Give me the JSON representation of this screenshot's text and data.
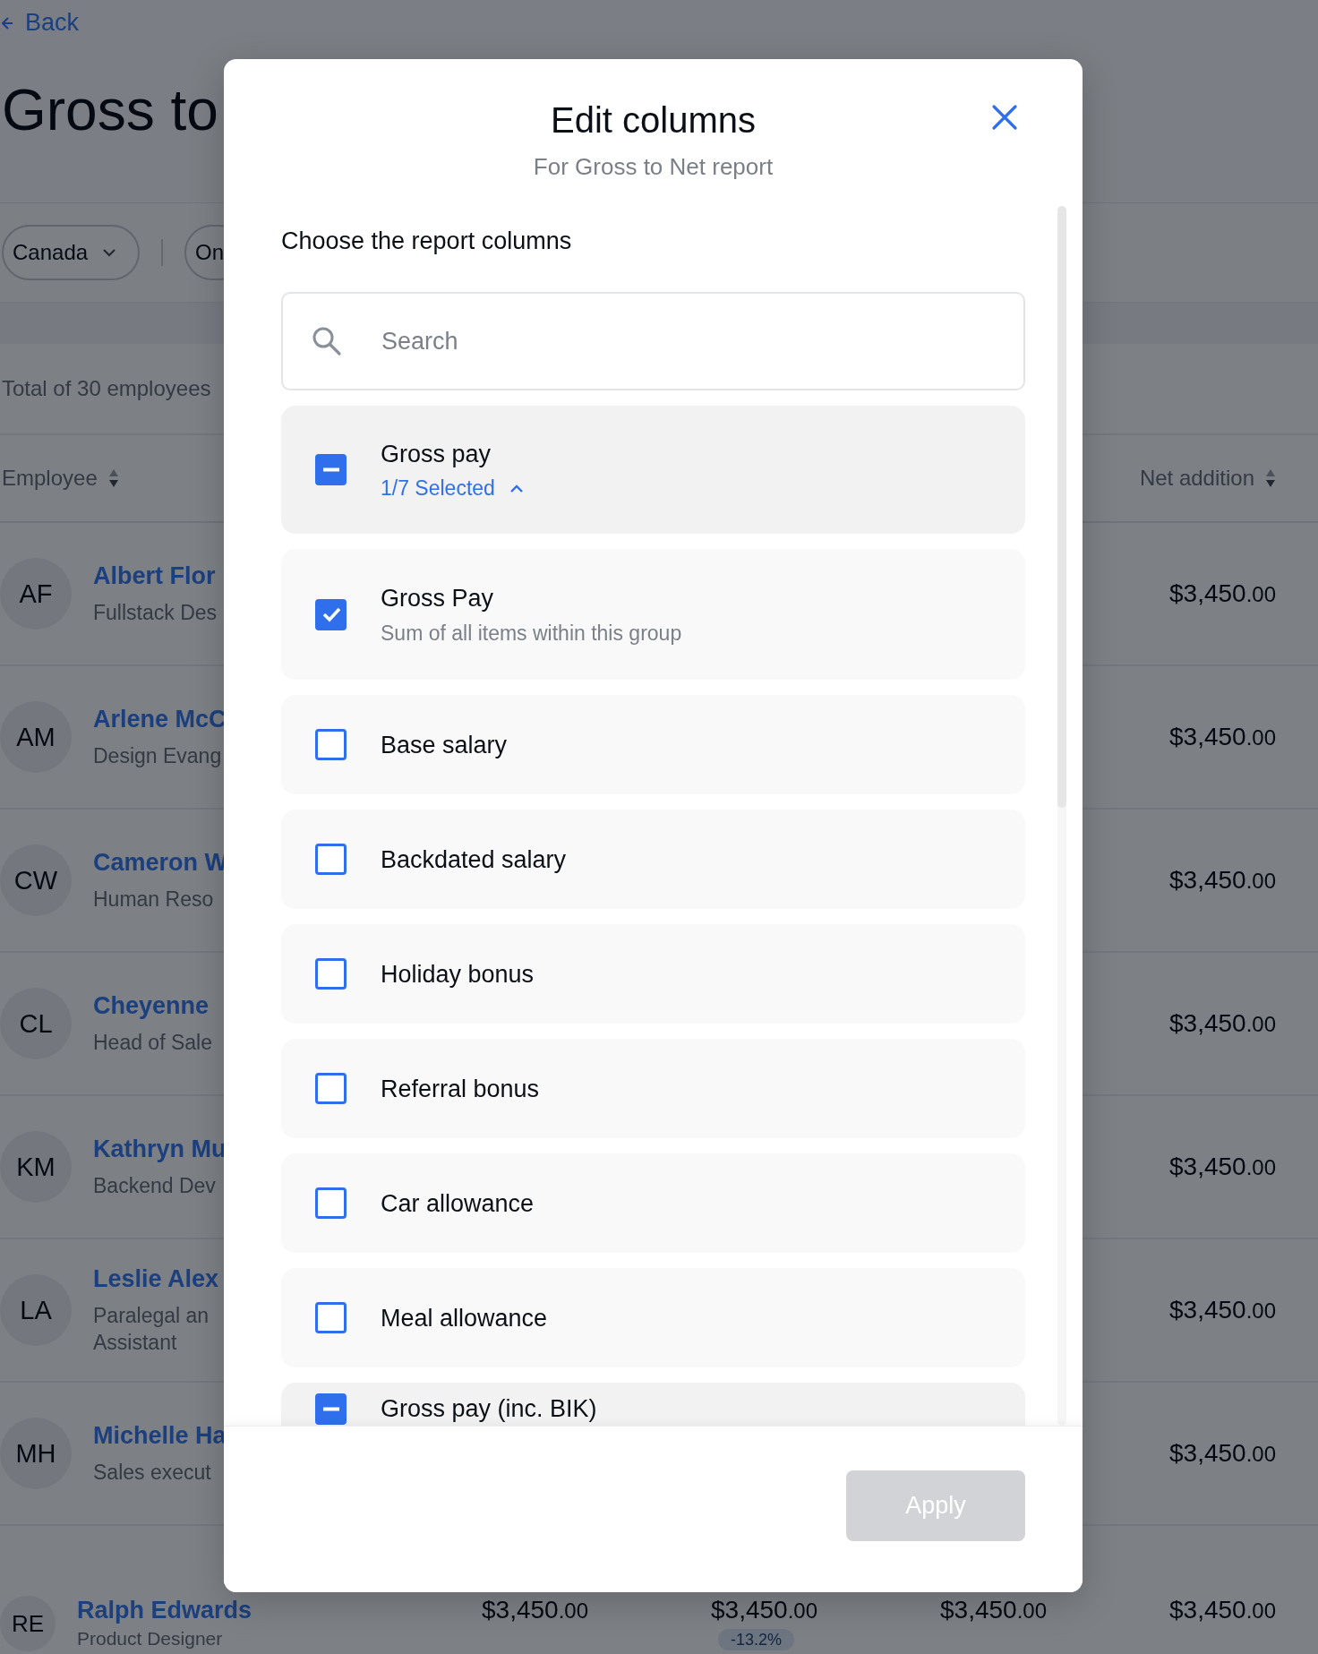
{
  "back_link": "Back",
  "page_title": "Gross to",
  "filters": [
    {
      "kind": "dropdown",
      "label": "Canada"
    },
    {
      "kind": "pill",
      "label": "On"
    }
  ],
  "total": "Total of 30 employees",
  "table": {
    "columns": [
      {
        "kind": "employee",
        "label": "Employee"
      },
      {
        "kind": "net",
        "label": "Net addition"
      }
    ],
    "rows": [
      {
        "initials": "AF",
        "name": "Albert Flor",
        "role": "Fullstack Des",
        "net_addition": "$3,450.00"
      },
      {
        "initials": "AM",
        "name": "Arlene McC",
        "role": "Design Evang",
        "net_addition": "$3,450.00"
      },
      {
        "initials": "CW",
        "name": "Cameron W",
        "role": "Human Reso",
        "net_addition": "$3,450.00"
      },
      {
        "initials": "CL",
        "name": "Cheyenne",
        "role": "Head of Sale",
        "net_addition": "$3,450.00"
      },
      {
        "initials": "KM",
        "name": "Kathryn Mu",
        "role": "Backend Dev",
        "net_addition": "$3,450.00"
      },
      {
        "initials": "LA",
        "name": "Leslie Alex",
        "role": "Paralegal an Assistant",
        "net_addition": "$3,450.00"
      },
      {
        "initials": "MH",
        "name": "Michelle Ha",
        "role": "Sales execut",
        "net_addition": "$3,450.00"
      },
      {
        "initials": "RE",
        "name": "Ralph Edwards",
        "role": "Product Designer",
        "net_addition": "$3,450.00",
        "other_amounts": [
          {
            "value": "$3,450.00"
          },
          {
            "value": "$3,450.00",
            "change": "-13.2%"
          },
          {
            "value": "$3,450.00"
          }
        ]
      }
    ]
  },
  "modal": {
    "title": "Edit columns",
    "subtitle": "For Gross to Net report",
    "prompt": "Choose the report columns",
    "search": {
      "placeholder": "Search"
    },
    "options": [
      {
        "kind": "group",
        "label": "Gross pay",
        "summary": "1/7 Selected",
        "checked": false,
        "indeterminate": true,
        "expanded": true
      },
      {
        "kind": "item",
        "label": "Gross Pay",
        "description": "Sum of all items within this group",
        "checked": true
      },
      {
        "kind": "item",
        "label": "Base salary",
        "checked": false
      },
      {
        "kind": "item",
        "label": "Backdated salary",
        "checked": false
      },
      {
        "kind": "item",
        "label": "Holiday bonus",
        "checked": false
      },
      {
        "kind": "item",
        "label": "Referral bonus",
        "checked": false
      },
      {
        "kind": "item",
        "label": "Car allowance",
        "checked": false
      },
      {
        "kind": "item",
        "label": "Meal allowance",
        "checked": false
      },
      {
        "kind": "group",
        "label": "Gross pay (inc. BIK)",
        "checked": false,
        "indeterminate": true
      }
    ],
    "apply_button": {
      "label": "Apply",
      "disabled": true
    }
  }
}
